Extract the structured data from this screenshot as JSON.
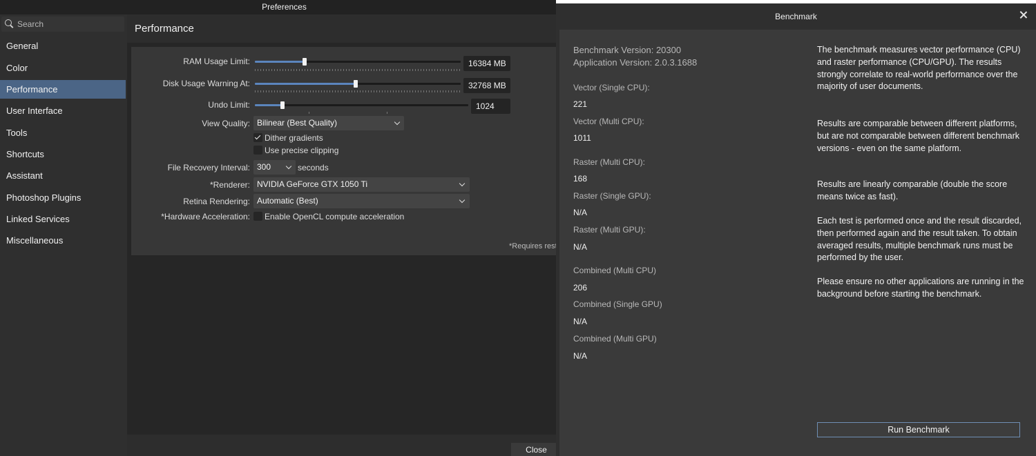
{
  "preferences": {
    "title": "Preferences",
    "search_placeholder": "Search",
    "sidebar_items": [
      "General",
      "Color",
      "Performance",
      "User Interface",
      "Tools",
      "Shortcuts",
      "Assistant",
      "Photoshop Plugins",
      "Linked Services",
      "Miscellaneous"
    ],
    "active_item": "Performance",
    "section_title": "Performance",
    "ram_label": "RAM Usage Limit:",
    "ram_value": "16384 MB",
    "ram_fraction": 0.24,
    "disk_label": "Disk Usage Warning At:",
    "disk_value": "32768 MB",
    "disk_fraction": 0.49,
    "undo_label": "Undo Limit:",
    "undo_value": "1024",
    "undo_fraction": 0.13,
    "view_quality_label": "View Quality:",
    "view_quality_value": "Bilinear (Best Quality)",
    "dither_label": "Dither gradients",
    "dither_checked": true,
    "precise_label": "Use precise clipping",
    "precise_checked": false,
    "recovery_label": "File Recovery Interval:",
    "recovery_value": "300",
    "recovery_unit": "seconds",
    "renderer_label": "*Renderer:",
    "renderer_value": "NVIDIA GeForce GTX 1050 Ti",
    "retina_label": "Retina Rendering:",
    "retina_value": "Automatic (Best)",
    "hwaccel_label": "*Hardware Acceleration:",
    "hwaccel_option": "Enable OpenCL compute acceleration",
    "hwaccel_checked": false,
    "requires_note": "*Requires rest",
    "close_label": "Close"
  },
  "benchmark": {
    "title": "Benchmark",
    "benchmark_version": "Benchmark Version: 20300",
    "application_version": "Application Version: 2.0.3.1688",
    "results": [
      {
        "label": "Vector (Single CPU):",
        "value": "221"
      },
      {
        "label": "Vector (Multi CPU):",
        "value": "1011"
      },
      {
        "label": "Raster (Multi CPU):",
        "value": "168"
      },
      {
        "label": "Raster (Single GPU):",
        "value": "N/A"
      },
      {
        "label": "Raster (Multi GPU):",
        "value": "N/A"
      },
      {
        "label": "Combined (Multi CPU)",
        "value": "206"
      },
      {
        "label": "Combined (Single GPU)",
        "value": "N/A"
      },
      {
        "label": "Combined (Multi GPU)",
        "value": "N/A"
      }
    ],
    "description": [
      "The benchmark measures vector performance (CPU) and raster performance (CPU/GPU). The results strongly correlate to real-world performance over the majority of user documents.",
      "Results are comparable between different platforms, but are not comparable between different benchmark versions - even on the same platform.",
      "Results are linearly comparable (double the score means twice as fast).",
      "Each test is performed once and the result discarded, then performed again and the result taken. To obtain averaged results, multiple benchmark runs must be performed by the user.",
      "Please ensure no other applications are running in the background before starting the benchmark."
    ],
    "run_label": "Run Benchmark"
  },
  "colors": {
    "accent": "#4b6586",
    "slider_fill": "#5b85bd",
    "button_border": "#6f8fb5"
  }
}
